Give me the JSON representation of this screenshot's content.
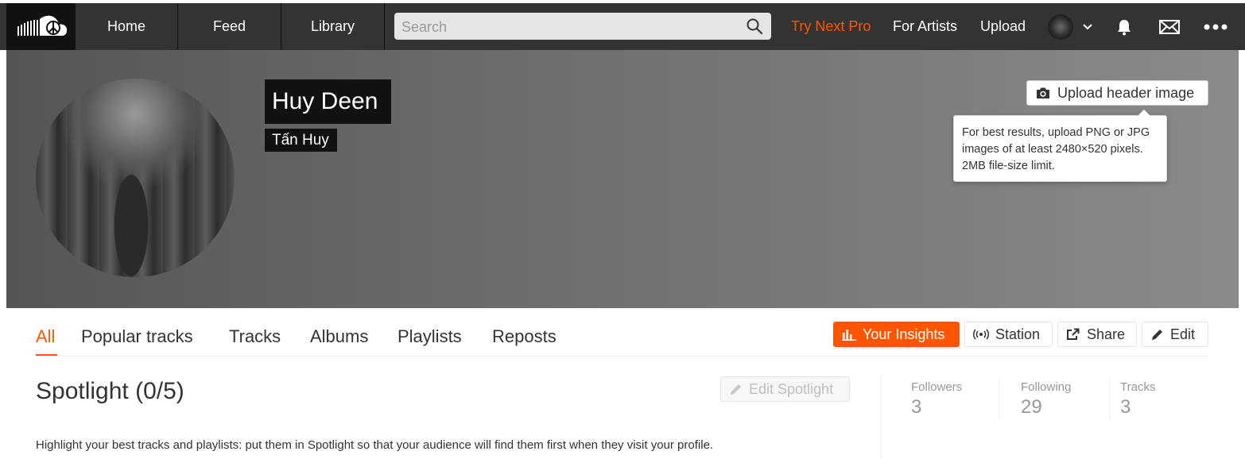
{
  "nav": {
    "items": [
      {
        "label": "Home"
      },
      {
        "label": "Feed"
      },
      {
        "label": "Library"
      }
    ],
    "search_placeholder": "Search",
    "try_pro": "Try Next Pro",
    "for_artists": "For Artists",
    "upload": "Upload",
    "icons": [
      "soundcloud-logo-icon",
      "search-icon",
      "chevron-down-icon",
      "bell-icon",
      "mail-icon",
      "more-icon"
    ],
    "accent_color": "#ff5500"
  },
  "profile": {
    "display_name": "Huy Deen",
    "real_name": "Tấn Huy",
    "upload_header_label": "Upload header image",
    "tooltip_text": "For best results, upload PNG or JPG images of at least 2480×520 pixels. 2MB file-size limit."
  },
  "tabs": [
    {
      "label": "All",
      "active": true
    },
    {
      "label": "Popular tracks"
    },
    {
      "label": "Tracks"
    },
    {
      "label": "Albums"
    },
    {
      "label": "Playlists"
    },
    {
      "label": "Reposts"
    }
  ],
  "actions": {
    "insights": "Your Insights",
    "station": "Station",
    "share": "Share",
    "edit": "Edit"
  },
  "spotlight": {
    "title": "Spotlight (0/5)",
    "edit_label": "Edit Spotlight",
    "description": "Highlight your best tracks and playlists: put them in Spotlight so that your audience will find them first when they visit your profile."
  },
  "stats": [
    {
      "label": "Followers",
      "value": "3"
    },
    {
      "label": "Following",
      "value": "29"
    },
    {
      "label": "Tracks",
      "value": "3"
    }
  ]
}
